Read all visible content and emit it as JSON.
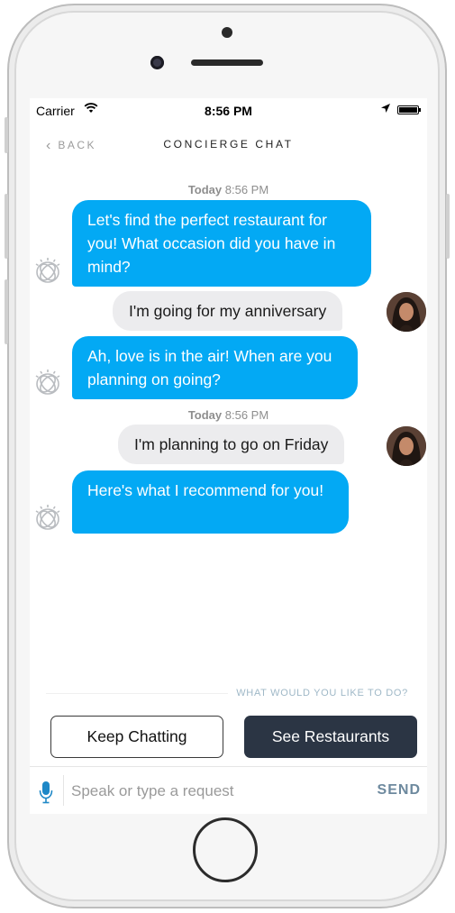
{
  "status_bar": {
    "carrier": "Carrier",
    "time": "8:56 PM",
    "wifi_icon": "wifi-icon",
    "location_icon": "location-arrow-icon",
    "battery_icon": "battery-icon"
  },
  "nav": {
    "back_label": "BACK",
    "title": "CONCIERGE CHAT"
  },
  "messages": [
    {
      "type": "timestamp",
      "day": "Today",
      "time": "8:56 PM"
    },
    {
      "type": "bot",
      "text": "Let's find the perfect restaurant for you! What occasion did you have in mind?"
    },
    {
      "type": "user",
      "text": "I'm going for my anniversary"
    },
    {
      "type": "bot",
      "text": "Ah, love is in the air! When are you planning on going?"
    },
    {
      "type": "timestamp",
      "day": "Today",
      "time": "8:56 PM"
    },
    {
      "type": "user",
      "text": "I'm planning to go on Friday"
    },
    {
      "type": "bot",
      "text": "Here's what I recommend for you!"
    }
  ],
  "prompt": "WHAT WOULD YOU LIKE TO DO?",
  "actions": {
    "keep_chatting": "Keep Chatting",
    "see_restaurants": "See Restaurants"
  },
  "input": {
    "placeholder": "Speak or type a request",
    "value": "",
    "send_label": "SEND"
  },
  "colors": {
    "bot_bubble": "#03a9f4",
    "user_bubble": "#ececee",
    "dark_button": "#2b3544",
    "send": "#6d899e"
  }
}
